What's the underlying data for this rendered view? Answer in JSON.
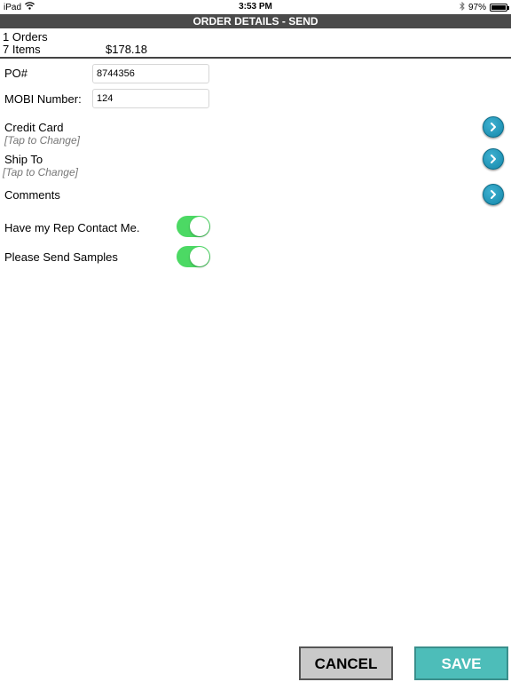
{
  "status_bar": {
    "device": "iPad",
    "time": "3:53 PM",
    "battery": "97%",
    "battery_level": 0.97
  },
  "header": {
    "title": "ORDER DETAILS - SEND"
  },
  "summary": {
    "orders": "1 Orders",
    "items": "7 Items",
    "total": "$178.18"
  },
  "form": {
    "po_label": "PO#",
    "po_value": "8744356",
    "mobi_label": "MOBI Number:",
    "mobi_value": "124"
  },
  "rows": {
    "credit_card_title": "Credit Card",
    "credit_card_sub": "[Tap to Change]",
    "ship_to_title": "Ship To",
    "ship_to_sub": "[Tap to Change]",
    "comments_title": "Comments"
  },
  "toggles": {
    "rep_contact_label": "Have my Rep Contact Me.",
    "rep_contact_on": true,
    "samples_label": "Please Send Samples",
    "samples_on": true
  },
  "buttons": {
    "cancel": "CANCEL",
    "save": "SAVE"
  },
  "colors": {
    "title_bar": "#4a4a4a",
    "toggle_on": "#4cd964",
    "arrow_button": "#1e9cc2",
    "save_button": "#4dbdb9",
    "cancel_button": "#c9c9c9"
  },
  "icons": {
    "wifi": "wifi-icon",
    "bluetooth": "bluetooth-icon",
    "battery": "battery-icon",
    "arrow": "chevron-right-icon"
  }
}
